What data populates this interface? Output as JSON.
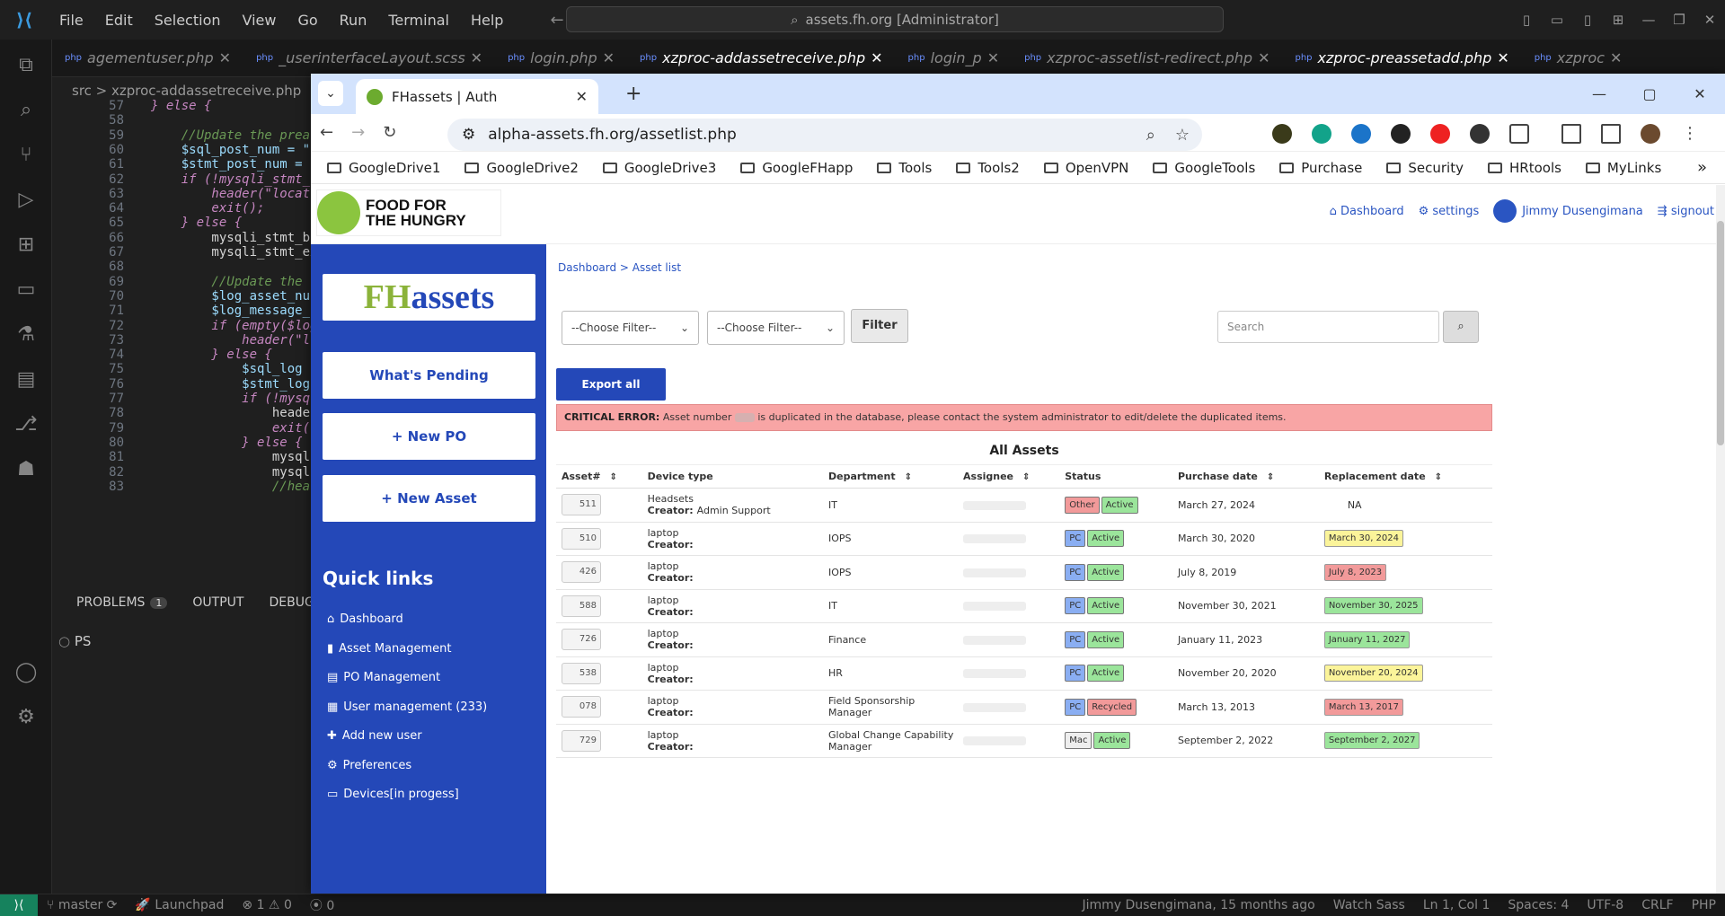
{
  "vscode": {
    "menu": [
      "File",
      "Edit",
      "Selection",
      "View",
      "Go",
      "Run",
      "Terminal",
      "Help"
    ],
    "command_center": "assets.fh.org [Administrator]",
    "tabs": [
      {
        "label": "agementuser.php",
        "active": false
      },
      {
        "label": "_userinterfaceLayout.scss",
        "active": false
      },
      {
        "label": "login.php",
        "active": false
      },
      {
        "label": "xzproc-addassetreceive.php",
        "active": true
      },
      {
        "label": "login_p",
        "active": false
      },
      {
        "label": "xzproc-assetlist-redirect.php",
        "active": false
      },
      {
        "label": "xzproc-preassetadd.php",
        "active": true
      },
      {
        "label": "xzproc",
        "active": false
      }
    ],
    "breadcrumb": "src > xzproc-addassetreceive.php",
    "line_numbers": [
      "57",
      "58",
      "59",
      "60",
      "61",
      "62",
      "63",
      "64",
      "65",
      "66",
      "67",
      "68",
      "69",
      "70",
      "71",
      "72",
      "73",
      "74",
      "75",
      "76",
      "77",
      "78",
      "79",
      "80",
      "81",
      "82",
      "83"
    ],
    "code_lines": [
      "} else {",
      "",
      "    //Update the prea",
      "    $sql_post_num = \"",
      "    $stmt_post_num = ",
      "    if (!mysqli_stmt_",
      "        header(\"locat",
      "        exit();",
      "    } else {",
      "        mysqli_stmt_b",
      "        mysqli_stmt_ex",
      "",
      "        //Update the ",
      "        $log_asset_nu",
      "        $log_message_",
      "        if (empty($log",
      "            header(\"l",
      "        } else {",
      "            $sql_log ",
      "            $stmt_log",
      "            if (!mysq",
      "                heade",
      "                exit(",
      "            } else {",
      "                mysql",
      "                mysql",
      "                //hea"
    ],
    "panel": {
      "problems": "PROBLEMS",
      "problems_count": "1",
      "output": "OUTPUT",
      "debug": "DEBUG C"
    },
    "terminal": "PS",
    "status": {
      "branch": "master",
      "launchpad": "Launchpad",
      "errors": "1",
      "warnings": "0",
      "ports": "0",
      "blame": "Jimmy Dusengimana, 15 months ago",
      "sass": "Watch Sass",
      "pos": "Ln 1, Col 1",
      "spaces": "Spaces: 4",
      "enc": "UTF-8",
      "eol": "CRLF",
      "lang": "PHP"
    }
  },
  "browser": {
    "tab_title": "FHassets | Auth",
    "url": "alpha-assets.fh.org/assetlist.php",
    "bookmarks": [
      "GoogleDrive1",
      "GoogleDrive2",
      "GoogleDrive3",
      "GoogleFHapp",
      "Tools",
      "Tools2",
      "OpenVPN",
      "GoogleTools",
      "Purchase",
      "Security",
      "HRtools",
      "MyLinks"
    ]
  },
  "app": {
    "logo_line1": "FOOD FOR",
    "logo_line2": "THE HUNGRY",
    "nav": {
      "dashboard": "Dashboard",
      "settings": "settings",
      "user": "Jimmy Dusengimana",
      "signout": "signout"
    },
    "brand_fh": "FH",
    "brand_assets": "assets",
    "sidebar_buttons": {
      "pending": "What's Pending",
      "new_po": "+ New PO",
      "new_asset": "+ New Asset"
    },
    "quick_links_title": "Quick links",
    "quick_links": [
      "Dashboard",
      "Asset Management",
      "PO Management",
      "User management (233)",
      "Add new user",
      "Preferences",
      "Devices[in progess]"
    ],
    "breadcrumb": {
      "home": "Dashboard",
      "sep": " > ",
      "current": "Asset list"
    },
    "filter1": "--Choose Filter--",
    "filter2": "--Choose Filter--",
    "filter_btn": "Filter",
    "search_placeholder": "Search",
    "export_btn": "Export all",
    "alert": {
      "label": "CRITICAL ERROR:",
      "pre": " Asset number ",
      "post": " is duplicated in the database, please contact the system administrator to edit/delete the duplicated items."
    },
    "table_title": "All Assets",
    "columns": [
      "Asset#",
      "Device type",
      "Department",
      "Assignee",
      "Status",
      "Purchase date",
      "Replacement date"
    ],
    "rows": [
      {
        "id": "511",
        "type": "Headsets",
        "creator_label": "Creator:",
        "creator": "Admin Support",
        "dept": "IT",
        "status1": "Other",
        "status2": "Active",
        "purchase": "March 27, 2024",
        "replacement": "NA",
        "rep_color": "none"
      },
      {
        "id": "510",
        "type": "laptop",
        "creator_label": "Creator:",
        "creator": "",
        "dept": "IOPS",
        "status1": "PC",
        "status2": "Active",
        "purchase": "March 30, 2020",
        "replacement": "March 30, 2024",
        "rep_color": "yellow"
      },
      {
        "id": "426",
        "type": "laptop",
        "creator_label": "Creator:",
        "creator": "",
        "dept": "IOPS",
        "status1": "PC",
        "status2": "Active",
        "purchase": "July 8, 2019",
        "replacement": "July 8, 2023",
        "rep_color": "red"
      },
      {
        "id": "588",
        "type": "laptop",
        "creator_label": "Creator:",
        "creator": "",
        "dept": "IT",
        "status1": "PC",
        "status2": "Active",
        "purchase": "November 30, 2021",
        "replacement": "November 30, 2025",
        "rep_color": "green"
      },
      {
        "id": "726",
        "type": "laptop",
        "creator_label": "Creator:",
        "creator": "",
        "dept": "Finance",
        "status1": "PC",
        "status2": "Active",
        "purchase": "January 11, 2023",
        "replacement": "January 11, 2027",
        "rep_color": "green"
      },
      {
        "id": "538",
        "type": "laptop",
        "creator_label": "Creator:",
        "creator": "",
        "dept": "HR",
        "status1": "PC",
        "status2": "Active",
        "purchase": "November 20, 2020",
        "replacement": "November 20, 2024",
        "rep_color": "yellow"
      },
      {
        "id": "078",
        "type": "laptop",
        "creator_label": "Creator:",
        "creator": "",
        "dept": "Field Sponsorship Manager",
        "status1": "PC",
        "status2": "Recycled",
        "purchase": "March 13, 2013",
        "replacement": "March 13, 2017",
        "rep_color": "red"
      },
      {
        "id": "729",
        "type": "laptop",
        "creator_label": "Creator:",
        "creator": "",
        "dept": "Global Change Capability Manager",
        "status1": "Mac",
        "status2": "Active",
        "purchase": "September 2, 2022",
        "replacement": "September 2, 2027",
        "rep_color": "green"
      }
    ]
  }
}
